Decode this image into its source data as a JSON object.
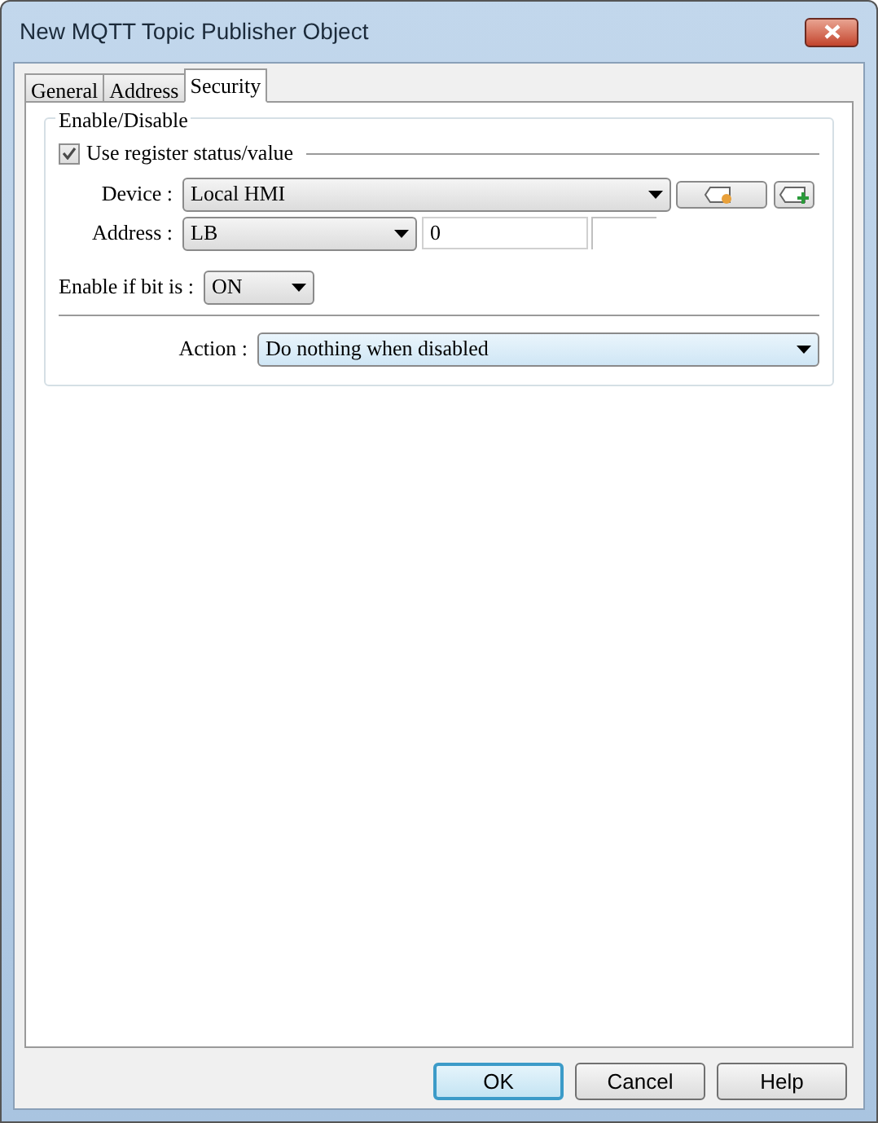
{
  "window": {
    "title": "New MQTT Topic Publisher Object"
  },
  "tabs": [
    {
      "label": "General",
      "selected": false
    },
    {
      "label": "Address",
      "selected": false
    },
    {
      "label": "Security",
      "selected": true
    }
  ],
  "group": {
    "title": "Enable/Disable",
    "use_register": {
      "label": "Use register status/value",
      "checked": true
    },
    "device": {
      "label": "Device :",
      "value": "Local HMI"
    },
    "address": {
      "label": "Address :",
      "type": "LB",
      "value": "0"
    },
    "enable_if": {
      "label": "Enable if bit is :",
      "value": "ON"
    },
    "action": {
      "label": "Action :",
      "value": "Do nothing when disabled"
    }
  },
  "buttons": [
    {
      "label": "OK",
      "default": true
    },
    {
      "label": "Cancel",
      "default": false
    },
    {
      "label": "Help",
      "default": false
    }
  ]
}
